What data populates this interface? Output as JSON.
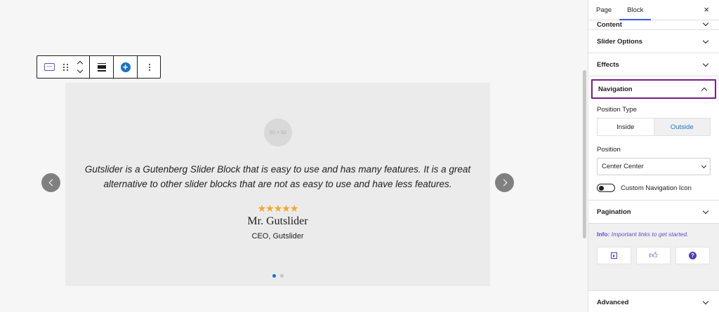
{
  "slider": {
    "avatar_placeholder": "50 × 50",
    "quote": "Gutslider is a Gutenberg Slider Block that is easy to use and has many features. It is a great alternative to other slider blocks that are not as easy to use and have less features.",
    "stars": "★★★★★",
    "rating": 5,
    "name": "Mr. Gutslider",
    "role": "CEO, Gutslider",
    "pagination": {
      "total": 2,
      "active": 1
    }
  },
  "sidebar": {
    "tabs": [
      "Page",
      "Block"
    ],
    "active_tab": "Block",
    "close": "×",
    "panels": {
      "content": "Content",
      "slider_options": "Slider Options",
      "effects": "Effects",
      "navigation": "Navigation",
      "pagination": "Pagination",
      "advanced": "Advanced"
    },
    "navigation": {
      "position_type_label": "Position Type",
      "position_type_options": [
        "Inside",
        "Outside"
      ],
      "position_type_selected": "Outside",
      "position_label": "Position",
      "position_value": "Center Center",
      "custom_icon_label": "Custom Navigation Icon",
      "custom_icon_enabled": false
    },
    "info": {
      "label": "Info:",
      "text": "Important links to get started."
    }
  },
  "icons": {
    "block": "slider-block-icon",
    "drag": "drag-handle-icon",
    "move": "move-up-down-icon",
    "align": "align-icon",
    "add": "plus-circle-icon",
    "more": "more-options-icon",
    "prev": "chevron-left-icon",
    "next": "chevron-right-icon",
    "help_video": "video-icon",
    "support": "thumbs-up-icon",
    "help": "help-icon"
  },
  "colors": {
    "accent": "#1a73c8",
    "highlight": "#7a1b87",
    "stars": "#f6a623",
    "info": "#5a4fcf"
  }
}
